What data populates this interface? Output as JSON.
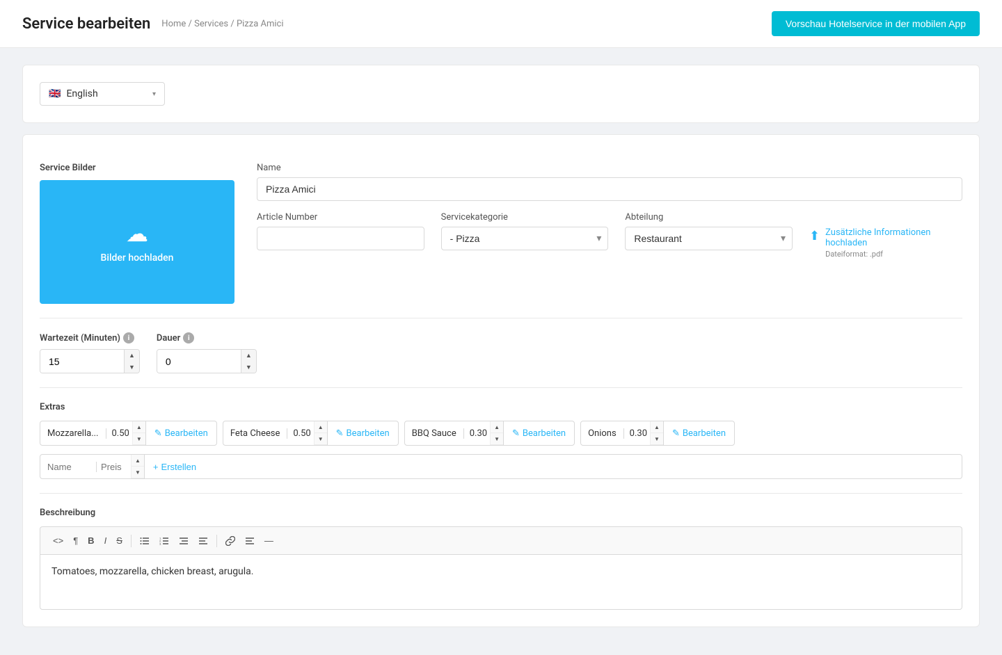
{
  "header": {
    "title": "Service bearbeiten",
    "breadcrumb": [
      "Home",
      "Services",
      "Pizza Amici"
    ],
    "preview_btn": "Vorschau Hotelservice in der mobilen App"
  },
  "language": {
    "selected": "English",
    "flag": "🇬🇧"
  },
  "service_images": {
    "label": "Service Bilder",
    "upload_label": "Bilder hochladen"
  },
  "name_field": {
    "label": "Name",
    "value": "Pizza Amici"
  },
  "article_number": {
    "label": "Article Number",
    "value": ""
  },
  "service_category": {
    "label": "Servicekategorie",
    "value": "- Pizza"
  },
  "department": {
    "label": "Abteilung",
    "value": "Restaurant"
  },
  "upload_info": {
    "label": "Zusätzliche Informationen hochladen",
    "sub": "Dateiformat: .pdf"
  },
  "wait_time": {
    "label": "Wartezeit (Minuten)",
    "value": "15"
  },
  "duration": {
    "label": "Dauer",
    "value": "0"
  },
  "extras": {
    "label": "Extras",
    "items": [
      {
        "name": "Mozzarella...",
        "price": "0.50"
      },
      {
        "name": "Feta Cheese",
        "price": "0.50"
      },
      {
        "name": "BBQ Sauce",
        "price": "0.30"
      },
      {
        "name": "Onions",
        "price": "0.30"
      }
    ],
    "edit_label": "Bearbeiten",
    "new_name_placeholder": "Name",
    "new_price_placeholder": "Preis",
    "create_label": "+Erstellen"
  },
  "description": {
    "label": "Beschreibung",
    "content": "Tomatoes, mozzarella, chicken breast, arugula.",
    "toolbar": {
      "code": "<>",
      "paragraph": "¶",
      "bold": "B",
      "italic": "I",
      "strikethrough": "S",
      "ul": "≡",
      "ol": "≡",
      "indent_left": "≡",
      "indent_right": "≡",
      "link": "🔗",
      "align": "≡",
      "hr": "—"
    }
  }
}
